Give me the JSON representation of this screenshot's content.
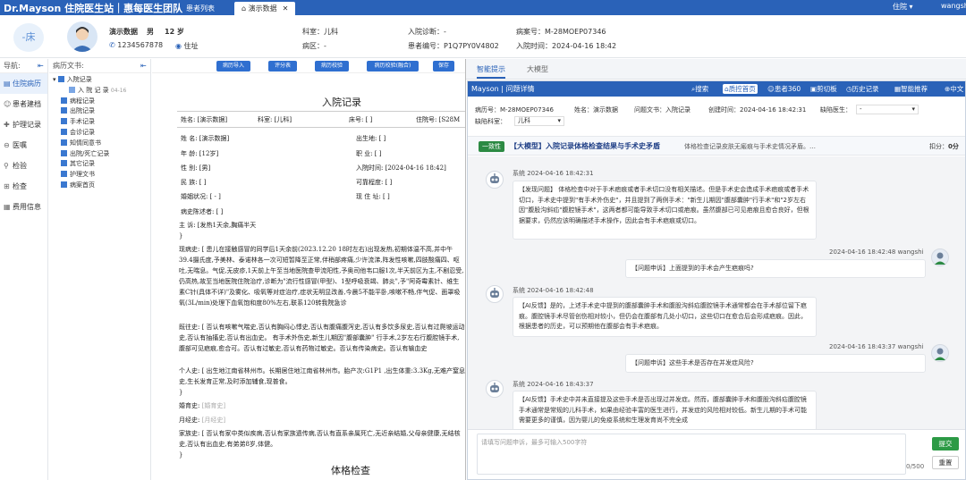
{
  "app": {
    "brand": "Dr.Mayson 住院医生站｜惠每医生团队",
    "tabs": [
      {
        "label": "患者列表",
        "active": false
      },
      {
        "label": "演示数据",
        "active": true
      }
    ],
    "hospital": "住院",
    "user": "wangshi",
    "accent_color": "#2a62b8"
  },
  "patient": {
    "bed_label": "-床",
    "name": "演示数据",
    "sex": "男",
    "age": "12 岁",
    "phone": "1234567878",
    "address_label": "住址",
    "dept": "科室：儿科",
    "ward": "病区：-",
    "admit_dx": "入院诊断：-",
    "patient_no": "患者编号：P1Q7PY0V4802",
    "case_no": "病案号：M-28MOEP07346",
    "admit_time": "入院时间：2024-04-16 18:42"
  },
  "left_nav": {
    "header": "导航:",
    "items": [
      {
        "label": "住院病历",
        "icon": "document-icon",
        "active": true
      },
      {
        "label": "患者建档",
        "icon": "user-icon",
        "active": false
      },
      {
        "label": "护理记录",
        "icon": "care-icon",
        "active": false
      },
      {
        "label": "医嘱",
        "icon": "pill-icon",
        "active": false
      },
      {
        "label": "检验",
        "icon": "test-tube-icon",
        "active": false
      },
      {
        "label": "检查",
        "icon": "scan-icon",
        "active": false
      },
      {
        "label": "费用信息",
        "icon": "fee-icon",
        "active": false
      }
    ]
  },
  "tree": {
    "header": "病历文书:",
    "nodes": [
      {
        "label": "入院记录",
        "level": 0,
        "expand": "▾"
      },
      {
        "label": "入 院 记 录",
        "level": 1,
        "date": "04-16"
      },
      {
        "label": "病程记录",
        "level": 0
      },
      {
        "label": "出院记录",
        "level": 0
      },
      {
        "label": "手术记录",
        "level": 0
      },
      {
        "label": "会诊记录",
        "level": 0
      },
      {
        "label": "知情同意书",
        "level": 0
      },
      {
        "label": "出院/死亡记录",
        "level": 0
      },
      {
        "label": "其它记录",
        "level": 0
      },
      {
        "label": "护理文书",
        "level": 0
      },
      {
        "label": "病案首页",
        "level": 0
      }
    ]
  },
  "doc_toolbar": [
    "病历导入",
    "评分表",
    "病历校验",
    "病历校验(融合)",
    "保存"
  ],
  "doc": {
    "title": "入院记录",
    "header_row": {
      "name": "姓名: [演示数据]",
      "dept": "科室: [儿科]",
      "bed": "床号: [ ]",
      "inpatient_no": "住院号: [S28M"
    },
    "fields": {
      "name": "姓 名: [演示数据]",
      "birthplace": "出生地: [ ]",
      "age": "年 龄: [12岁]",
      "occupation": "职 业: [ ]",
      "sex": "性 别: [男]",
      "admit_time": "入院时间: [2024-04-16 18:42]",
      "ethnicity": "民 族: [ ]",
      "reliability": "可靠程度: [ ]",
      "marital": "婚姻状况: [ - ]",
      "address": "现 住 址: [ ]",
      "narrator": "病史陈述者: [ ]"
    },
    "complaint": "主  诉: [发热1天余,胸痛半天",
    "present_illness": "现病史: [ 患儿在接触感冒的同学后1天余前(2023.12.20 18时左右)出现发热,初期体温不高,并中午39.4摄氏度,予美林、泰诺林各一次可短暂降至正常,伴稍部疼痛,少许流涕,阵发性咳嗽,四肢酸痛四、呕吐,无喘息。气促,无皮疹,1天前上午至当地医院查甲流阳性,予奥司他韦口服1次,半天前区为主,不剧忍受,仍高热,故至当地医院住院治疗,诊断为\"流行性感冒(甲型)、1型呼吸衰竭、肺炎\",予\"阿奇霉素针、维生素C针(具体不详)\"及雾化、吸氧等对症治疗,症状无明显改善,今晨5不能平卧,咳嗽不畅,伴气促、面罩吸氧(3L/min)处理下血氧饱和度80%左右,联系120转我院急诊",
    "past_history": "既往史: [ 否认有咳嗽气喘史,否认有胸闷心悸史,否认有腹痛腹泻史,否认有多饮多尿史,否认有过爬坡运动史,否认有抽搐史,否认有出血史。 有手术外伤史,新生儿期因\"腹部囊肿\" 行手术,2岁左右行腹腔镜手术,腹部可见疤痕,愈合可。否认有过敏史,否认有药物过敏史。否认有传染病史。否认有输血史",
    "personal_history": "个人史: [ 出生地江南省林州市。长期居住地江南省林州市。胎产次:G1P1 ,出生体重:3.3Kg,无难产窒息史,生长发育正常,及时添加辅食,现普食。",
    "close1": "}",
    "close2": "}",
    "close3": "}",
    "marriage_history_label": "婚育史:",
    "marriage_history_value": "[婚育史]",
    "menstrual_history_label": "月经史:",
    "menstrual_history_value": "[月经史]",
    "family_history": "家族史: [ 否认有家中类似疾病,否认有家族遗传病,否认有直系亲属死亡,无近亲结婚,父母亲健康,无结核史,否认有出血史,有弟弟8岁,体健。",
    "section_exam": "体格检查"
  },
  "ai_tabs": [
    {
      "label": "智能提示",
      "active": true
    },
    {
      "label": "大模型",
      "active": false
    }
  ],
  "panel": {
    "title": "Mayson | 问题详情",
    "menu": [
      {
        "label": "搜索",
        "icon": "search-icon",
        "active": false
      },
      {
        "label": "质控首页",
        "icon": "home-icon",
        "active": true
      },
      {
        "label": "患者360",
        "icon": "patient-icon",
        "active": false
      },
      {
        "label": "剪切板",
        "icon": "clipboard-icon",
        "active": false
      },
      {
        "label": "历史记录",
        "icon": "history-icon",
        "active": false
      },
      {
        "label": "智能推荐",
        "icon": "recommend-icon",
        "active": false
      },
      {
        "label": "中文",
        "icon": "language-icon",
        "active": false
      }
    ],
    "info": {
      "case_no_label": "病历号：",
      "case_no": "M-28MOEP07346",
      "name_label": "姓名：",
      "name": "演示数据",
      "doc_label": "问题文书：",
      "doc": "入院记录",
      "created_label": "创建时间：",
      "created": "2024-04-16 18:42:31",
      "defect_doctor_label": "缺陷医生：",
      "defect_doctor": "-",
      "defect_dept_label": "缺陷科室：",
      "defect_dept": "儿科"
    },
    "issue": {
      "badge": "一致性",
      "title": "【大模型】入院记录体格检查结果与手术史矛盾",
      "desc": "体格检查记录皮肤无瘢痕与手术史情况矛盾。…",
      "score_label": "扣分：",
      "score": "0分"
    },
    "messages": [
      {
        "from": "bot",
        "header": "系统  2024-04-16 18:42:31",
        "text": "【发现问题】 体格检查中对于手术疤痕或者手术切口没有相关描述。但是手术史会造成手术疤痕或者手术切口，手术史中提到\"有手术外伤史\"，并且提到了两例手术：\"新生儿期因\"腹部囊肿\"行手术\"和\"2岁左右因\"腹股沟斜疝\"腹腔镜手术\"，这两者都可能导致手术切口或疤痕。虽然腹部已可见疤痕且愈合良好，但根据要求，仍然应该明确描述手术操作，因此会有手术疤痕或切口。"
      },
      {
        "from": "user",
        "header": "2024-04-16 18:42:48 wangshi",
        "text": "【问题申诉】上面提到的手术会产生疤痕吗?"
      },
      {
        "from": "bot",
        "header": "系统  2024-04-16 18:42:48",
        "text": "【AI反馈】是的，上述手术史中提到的腹部囊肿手术和腹股沟斜疝腹腔镜手术通常都会在手术部位留下疤痕。腹腔镜手术尽管创伤相对较小，但仍会在腹部有几处小切口，这些切口在愈合后会形成疤痕。因此，根据患者的历史，可以预期他在腹部会有手术疤痕。"
      },
      {
        "from": "user",
        "header": "2024-04-16 18:43:37 wangshi",
        "text": "【问题申诉】这些手术是否存在并发症风险?"
      },
      {
        "from": "bot",
        "header": "系统  2024-04-16 18:43:37",
        "text": "【AI反馈】手术史中并未直接提及这些手术是否出现过并发症。然而，腹部囊肿手术和腹股沟斜疝腹腔镜手术通常是常规的儿科手术，如果由经验丰富的医生进行，并发症的风险相对较低。新生儿期的手术可能需要更多的谨慎，因为婴儿的免疫系统和生理发育尚不完全成"
      }
    ],
    "input_placeholder": "请填写问题申诉，最多可输入500字符",
    "counter": "0/500",
    "submit_label": "提交",
    "reset_label": "重置"
  }
}
